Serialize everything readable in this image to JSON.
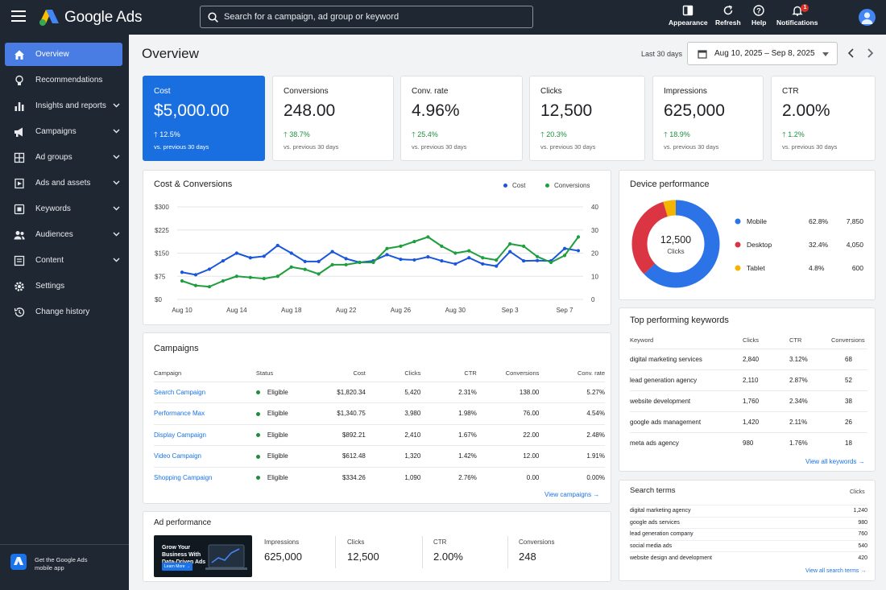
{
  "app": {
    "name": "Google Ads"
  },
  "search": {
    "placeholder": "Search for a campaign, ad group or keyword"
  },
  "toolbar": {
    "appearance": "Appearance",
    "refresh": "Refresh",
    "help": "Help",
    "notifications": "Notifications",
    "notification_count": "1"
  },
  "sidebar": {
    "items": [
      {
        "label": "Overview",
        "icon": "home-icon",
        "active": true
      },
      {
        "label": "Recommendations",
        "icon": "lightbulb-icon"
      },
      {
        "label": "Insights and reports",
        "icon": "bar-chart-icon",
        "expandable": true
      },
      {
        "label": "Campaigns",
        "icon": "megaphone-icon",
        "expandable": true
      },
      {
        "label": "Ad groups",
        "icon": "grid-icon",
        "expandable": true
      },
      {
        "label": "Ads and assets",
        "icon": "ad-icon",
        "expandable": true
      },
      {
        "label": "Keywords",
        "icon": "key-icon",
        "expandable": true
      },
      {
        "label": "Audiences",
        "icon": "people-icon",
        "expandable": true
      },
      {
        "label": "Content",
        "icon": "content-icon",
        "expandable": true
      },
      {
        "label": "Settings",
        "icon": "gear-icon"
      },
      {
        "label": "Change history",
        "icon": "history-icon"
      }
    ],
    "mobile_app": "Get the Google Ads mobile app"
  },
  "header": {
    "title": "Overview",
    "range_label": "Last 30 days",
    "date_range": "Aug 10, 2025 – Sep 8, 2025"
  },
  "kpis": [
    {
      "label": "Cost",
      "value": "$5,000.00",
      "delta": "12.5%",
      "sub": "vs. previous 30 days"
    },
    {
      "label": "Conversions",
      "value": "248.00",
      "delta": "38.7%",
      "sub": "vs. previous 30 days"
    },
    {
      "label": "Conv. rate",
      "value": "4.96%",
      "delta": "25.4%",
      "sub": "vs. previous 30 days"
    },
    {
      "label": "Clicks",
      "value": "12,500",
      "delta": "20.3%",
      "sub": "vs. previous 30 days"
    },
    {
      "label": "Impressions",
      "value": "625,000",
      "delta": "18.9%",
      "sub": "vs. previous 30 days"
    },
    {
      "label": "CTR",
      "value": "2.00%",
      "delta": "1.2%",
      "sub": "vs. previous 30 days"
    }
  ],
  "cost_chart": {
    "title": "Cost & Conversions",
    "legend": [
      "Cost",
      "Conversions"
    ],
    "y_left_ticks": [
      "$300",
      "$225",
      "$150",
      "$75",
      "$0"
    ],
    "y_right_ticks": [
      "40",
      "30",
      "20",
      "10",
      "0"
    ],
    "x_ticks": [
      "Aug 10",
      "Aug 14",
      "Aug 18",
      "Aug 22",
      "Aug 26",
      "Aug 30",
      "Sep 3",
      "Sep 7"
    ]
  },
  "chart_data": [
    {
      "type": "line",
      "title": "Cost & Conversions",
      "x": [
        "Aug 10",
        "Aug 11",
        "Aug 12",
        "Aug 13",
        "Aug 14",
        "Aug 15",
        "Aug 16",
        "Aug 17",
        "Aug 18",
        "Aug 19",
        "Aug 20",
        "Aug 21",
        "Aug 22",
        "Aug 23",
        "Aug 24",
        "Aug 25",
        "Aug 26",
        "Aug 27",
        "Aug 28",
        "Aug 29",
        "Aug 30",
        "Aug 31",
        "Sep 1",
        "Sep 2",
        "Sep 3",
        "Sep 4",
        "Sep 5",
        "Sep 6",
        "Sep 7",
        "Sep 8"
      ],
      "series": [
        {
          "name": "Cost",
          "axis": "left",
          "color": "#1a56db",
          "values": [
            88,
            80,
            98,
            125,
            150,
            135,
            140,
            175,
            150,
            123,
            123,
            155,
            132,
            120,
            125,
            145,
            130,
            128,
            138,
            125,
            115,
            135,
            115,
            108,
            155,
            125,
            126,
            125,
            165,
            158
          ]
        },
        {
          "name": "Conversions",
          "axis": "right",
          "color": "#1e9e3e",
          "values": [
            8,
            6,
            5.5,
            8,
            10,
            9.5,
            9,
            10,
            14,
            13,
            11,
            15,
            15,
            16,
            16,
            22,
            23,
            25,
            27,
            23,
            20,
            21,
            18,
            17,
            24,
            23,
            18.5,
            16,
            19,
            27
          ]
        }
      ],
      "ylim_left": [
        0,
        300
      ],
      "ylim_right": [
        0,
        40
      ]
    },
    {
      "type": "pie",
      "title": "Device performance",
      "center_value": "12,500",
      "center_label": "Clicks",
      "slices": [
        {
          "name": "Mobile",
          "pct": "62.8%",
          "share": 62.8,
          "value": "7,850",
          "color": "#2b73e6"
        },
        {
          "name": "Desktop",
          "pct": "32.4%",
          "share": 32.4,
          "value": "4,050",
          "color": "#db3544"
        },
        {
          "name": "Tablet",
          "pct": "4.8%",
          "share": 4.8,
          "value": "600",
          "color": "#f4b400"
        }
      ]
    }
  ],
  "campaigns": {
    "title": "Campaigns",
    "headers": [
      "Campaign",
      "Status",
      "Cost",
      "Clicks",
      "CTR",
      "Conversions",
      "Conv. rate"
    ],
    "rows": [
      {
        "name": "Search Campaign",
        "status": "Eligible",
        "cost": "$1,820.34",
        "clicks": "5,420",
        "ctr": "2.31%",
        "conv": "138.00",
        "rate": "5.27%"
      },
      {
        "name": "Performance Max",
        "status": "Eligible",
        "cost": "$1,340.75",
        "clicks": "3,980",
        "ctr": "1.98%",
        "conv": "76.00",
        "rate": "4.54%"
      },
      {
        "name": "Display Campaign",
        "status": "Eligible",
        "cost": "$892.21",
        "clicks": "2,410",
        "ctr": "1.67%",
        "conv": "22.00",
        "rate": "2.48%"
      },
      {
        "name": "Video Campaign",
        "status": "Eligible",
        "cost": "$612.48",
        "clicks": "1,320",
        "ctr": "1.42%",
        "conv": "12.00",
        "rate": "1.91%"
      },
      {
        "name": "Shopping Campaign",
        "status": "Eligible",
        "cost": "$334.26",
        "clicks": "1,090",
        "ctr": "2.76%",
        "conv": "0.00",
        "rate": "0.00%"
      }
    ],
    "view_all": "View campaigns →"
  },
  "device": {
    "title": "Device performance"
  },
  "keywords": {
    "title": "Top performing keywords",
    "headers": [
      "Keyword",
      "Clicks",
      "CTR",
      "Conversions"
    ],
    "rows": [
      {
        "kw": "digital marketing services",
        "clicks": "2,840",
        "ctr": "3.12%",
        "conv": "68"
      },
      {
        "kw": "lead generation agency",
        "clicks": "2,110",
        "ctr": "2.87%",
        "conv": "52"
      },
      {
        "kw": "website development",
        "clicks": "1,760",
        "ctr": "2.34%",
        "conv": "38"
      },
      {
        "kw": "google ads management",
        "clicks": "1,420",
        "ctr": "2.11%",
        "conv": "26"
      },
      {
        "kw": "meta ads agency",
        "clicks": "980",
        "ctr": "1.76%",
        "conv": "18"
      }
    ],
    "view_all": "View all keywords →"
  },
  "search_terms": {
    "title": "Search terms",
    "header_clicks": "Clicks",
    "rows": [
      {
        "term": "digital marketing agency",
        "clicks": "1,240"
      },
      {
        "term": "google ads services",
        "clicks": "980"
      },
      {
        "term": "lead generation company",
        "clicks": "760"
      },
      {
        "term": "social media ads",
        "clicks": "540"
      },
      {
        "term": "website design and development",
        "clicks": "420"
      }
    ],
    "view_all": "View all search terms →"
  },
  "ad_performance": {
    "title": "Ad performance",
    "creative_headline": "Grow Your Business With Data-Driven Ads",
    "creative_cta": "Learn More →",
    "metrics": [
      {
        "label": "Impressions",
        "value": "625,000"
      },
      {
        "label": "Clicks",
        "value": "12,500"
      },
      {
        "label": "CTR",
        "value": "2.00%"
      },
      {
        "label": "Conversions",
        "value": "248"
      }
    ]
  }
}
